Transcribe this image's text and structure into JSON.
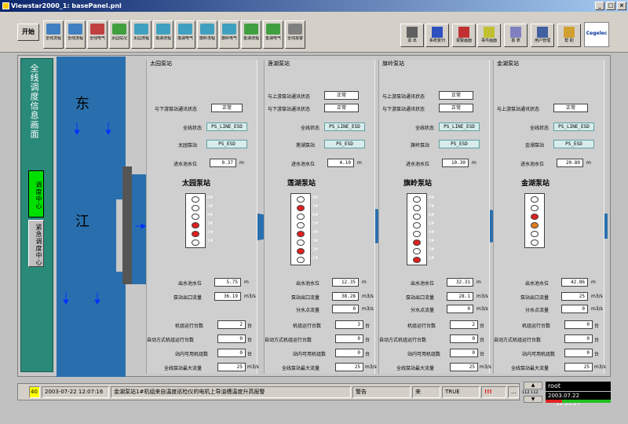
{
  "window": {
    "title": "Viewstar2000_1: basePanel.pnl",
    "min": "_",
    "max": "□",
    "close": "×"
  },
  "toolbar": {
    "start_label": "开始",
    "buttons": [
      {
        "label": "全线流程",
        "color": "#4080c0"
      },
      {
        "label": "全线流程",
        "color": "#4080c0"
      },
      {
        "label": "全线电气",
        "color": "#c04040"
      },
      {
        "label": "太园站况",
        "color": "#40a040"
      },
      {
        "label": "太园流程",
        "color": "#40a0c0"
      },
      {
        "label": "莲湖流程",
        "color": "#40a0c0"
      },
      {
        "label": "莲湖电气",
        "color": "#40a0c0"
      },
      {
        "label": "旗岭流程",
        "color": "#40a0c0"
      },
      {
        "label": "旗岭电气",
        "color": "#40a0c0"
      },
      {
        "label": "金湖流程",
        "color": "#40a040"
      },
      {
        "label": "金湖电气",
        "color": "#40a040"
      },
      {
        "label": "全线报警",
        "color": "#808080"
      }
    ],
    "right_buttons": [
      {
        "label": "退 出",
        "color": "#606060"
      },
      {
        "label": "系统复归",
        "color": "#3050c0"
      },
      {
        "label": "报警画面",
        "color": "#c03030"
      },
      {
        "label": "事件画面",
        "color": "#c0c030"
      },
      {
        "label": "报 表",
        "color": "#8080c0"
      },
      {
        "label": "用户管理",
        "color": "#4060a0"
      },
      {
        "label": "帮 助",
        "color": "#d0a030"
      }
    ],
    "logo": "Cegelec"
  },
  "left": {
    "title": "全线调度信息画面",
    "btn_dispatch": "调度中心",
    "btn_emergency": "紧急调度中心"
  },
  "river": {
    "char1": "东",
    "char2": "江"
  },
  "stations": [
    {
      "panel": "太园泵站",
      "label": "太园泵站",
      "upstream": "",
      "downstream": "与下游泵站通讯状态",
      "up_value": "",
      "down_value": "正常",
      "line_status_label": "全线状态",
      "line_status": "PS_LINE_ESD",
      "station_status_label": "太园泵站",
      "station_status": "PS_ESD",
      "inlet_label": "进水池水位",
      "inlet": "0.37",
      "inlet_unit": "m",
      "outlet_label": "出水池水位",
      "outlet": "5.75",
      "outlet_unit": "m",
      "flow_label": "泵站出口流量",
      "flow": "36.19",
      "flow_unit": "m3/s",
      "branch_label": "",
      "branch": "",
      "running_label": "机组运行台数",
      "running": "2",
      "running_unit": "台",
      "auto_label": "自动方式机组运行台数",
      "auto": "0",
      "auto_unit": "台",
      "avail_label": "站内可用机组数",
      "avail": "0",
      "avail_unit": "台",
      "max_label": "全线泵站最大流量",
      "max": "25",
      "max_unit": "m3/s",
      "pumps": [
        "#fff",
        "#fff",
        "#fff",
        "#e02020",
        "#e02020",
        "#fff"
      ],
      "pump_nums": [
        "6#",
        "5#",
        "4#",
        "3#",
        "2#",
        "1#"
      ]
    },
    {
      "panel": "莲湖泵站",
      "label": "莲湖泵站",
      "upstream": "与上游泵站通讯状态",
      "downstream": "与下游泵站通讯状态",
      "up_value": "正常",
      "down_value": "正常",
      "line_status_label": "全线状态",
      "line_status": "PS_LINE_ESD",
      "station_status_label": "莲湖泵站",
      "station_status": "PS_ESD",
      "inlet_label": "进水池水位",
      "inlet": "4.10",
      "inlet_unit": "m",
      "outlet_label": "出水池水位",
      "outlet": "12.35",
      "outlet_unit": "m",
      "flow_label": "泵站出口流量",
      "flow": "38.28",
      "flow_unit": "m3/s",
      "branch_label": "分水点流量",
      "branch": "0",
      "branch_unit": "m3/s",
      "running_label": "机组运行台数",
      "running": "3",
      "running_unit": "台",
      "auto_label": "自动方式机组运行台数",
      "auto": "0",
      "auto_unit": "台",
      "avail_label": "站内可用机组数",
      "avail": "0",
      "avail_unit": "台",
      "max_label": "全线泵站最大流量",
      "max": "25",
      "max_unit": "m3/s",
      "pumps": [
        "#fff",
        "#e02020",
        "#fff",
        "#fff",
        "#e02020",
        "#fff",
        "#e02020",
        "#fff"
      ],
      "pump_nums": [
        "8#",
        "7#",
        "6#",
        "5#",
        "4#",
        "3#",
        "2#",
        "1#"
      ]
    },
    {
      "panel": "旗岭泵站",
      "label": "旗岭泵站",
      "upstream": "与上游泵站通讯状态",
      "downstream": "与下游泵站通讯状态",
      "up_value": "正常",
      "down_value": "正常",
      "line_status_label": "全线状态",
      "line_status": "PS_LINE_ESD",
      "station_status_label": "旗岭泵站",
      "station_status": "PS_ESD",
      "inlet_label": "进水池水位",
      "inlet": "10.30",
      "inlet_unit": "m",
      "outlet_label": "出水池水位",
      "outlet": "32.31",
      "outlet_unit": "m",
      "flow_label": "泵站出口流量",
      "flow": "28.1",
      "flow_unit": "m3/s",
      "branch_label": "分水点流量",
      "branch": "0",
      "branch_unit": "m3/s",
      "running_label": "机组运行台数",
      "running": "2",
      "running_unit": "台",
      "auto_label": "自动方式机组运行台数",
      "auto": "0",
      "auto_unit": "台",
      "avail_label": "站内可用机组数",
      "avail": "0",
      "avail_unit": "台",
      "max_label": "全线泵站最大流量",
      "max": "25",
      "max_unit": "m3/s",
      "pumps": [
        "#fff",
        "#fff",
        "#fff",
        "#fff",
        "#fff",
        "#e02020",
        "#fff",
        "#e02020"
      ],
      "pump_nums": [
        "8#",
        "7#",
        "6#",
        "5#",
        "4#",
        "3#",
        "2#",
        "1#"
      ]
    },
    {
      "panel": "金湖泵站",
      "label": "金湖泵站",
      "upstream": "",
      "downstream": "与上游泵站通讯状态",
      "up_value": "",
      "down_value": "正常",
      "line_status_label": "全线状态",
      "line_status": "PS_LINE_ESD",
      "station_status_label": "金湖泵站",
      "station_status": "PS_ESD",
      "inlet_label": "进水池水位",
      "inlet": "20.80",
      "inlet_unit": "m",
      "outlet_label": "出水池水位",
      "outlet": "42.86",
      "outlet_unit": "m",
      "flow_label": "泵站出口流量",
      "flow": "25",
      "flow_unit": "m3/s",
      "branch_label": "分水点流量",
      "branch": "0",
      "branch_unit": "m3/s",
      "running_label": "机组运行台数",
      "running": "0",
      "running_unit": "台",
      "auto_label": "自动方式机组运行台数",
      "auto": "0",
      "auto_unit": "台",
      "avail_label": "站内可用机组数",
      "avail": "0",
      "avail_unit": "台",
      "max_label": "全线泵站最大流量",
      "max": "25",
      "max_unit": "m3/s",
      "pumps": [
        "#fff",
        "#fff",
        "#e02020",
        "#e08020",
        "#fff",
        "#fff"
      ],
      "pump_nums": [
        "",
        "",
        "",
        "",
        "",
        ""
      ]
    }
  ],
  "alarm": {
    "count": "40",
    "time": "2003-07-22 12:07:16",
    "text": "金湖泵站1#机组来自温度巡检仪的电机上导油槽温度升高报警",
    "level": "警告",
    "state": "来",
    "ack": "TRUE",
    "prio": "!!!",
    "more": "..."
  },
  "session": {
    "user": "root",
    "date": "2003.07.22",
    "time": "12:21:27",
    "counter": "112 112"
  }
}
